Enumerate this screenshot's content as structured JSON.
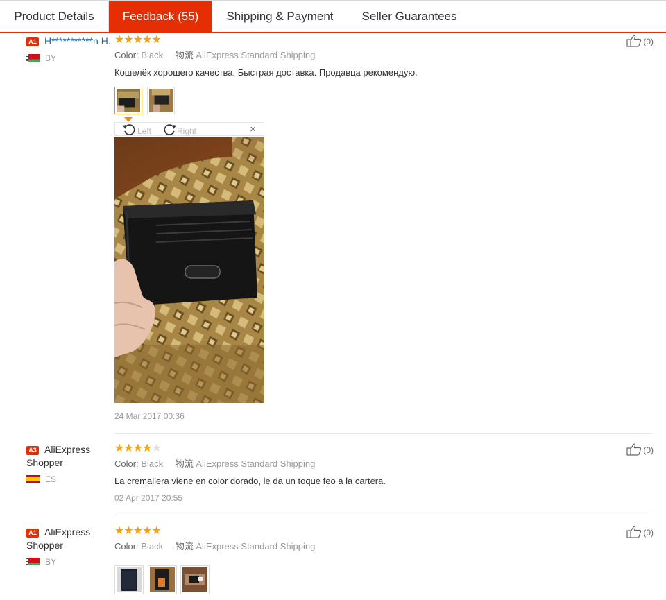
{
  "tabs": [
    {
      "label": "Product Details"
    },
    {
      "label": "Feedback (55)"
    },
    {
      "label": "Shipping & Payment"
    },
    {
      "label": "Seller Guarantees"
    }
  ],
  "reviews": [
    {
      "level": "A1",
      "name": "H***********n H.",
      "country": "BY",
      "rating": 5,
      "color_label": "Color:",
      "color_value": "Black",
      "shipping_label": "物流",
      "shipping_value": "AliExpress Standard Shipping",
      "text": "Кошелёк хорошего качества. Быстрая доставка. Продавца рекомендую.",
      "date": "24 Mar 2017 00:36",
      "helpful": "(0)",
      "viewer": {
        "rotate_left": "Left",
        "rotate_right": "Right",
        "close": "×"
      }
    },
    {
      "level": "A3",
      "name": "AliExpress Shopper",
      "country": "ES",
      "rating": 4,
      "color_label": "Color:",
      "color_value": "Black",
      "shipping_label": "物流",
      "shipping_value": "AliExpress Standard Shipping",
      "text": "La cremallera viene en color dorado, le da un toque feo a la cartera.",
      "date": "02 Apr 2017 20:55",
      "helpful": "(0)"
    },
    {
      "level": "A1",
      "name": "AliExpress Shopper",
      "country": "BY",
      "rating": 5,
      "color_label": "Color:",
      "color_value": "Black",
      "shipping_label": "物流",
      "shipping_value": "AliExpress Standard Shipping",
      "helpful": "(0)"
    }
  ],
  "colors": {
    "accent": "#e62e04",
    "star": "#f5a20a",
    "link": "#1c69b1"
  }
}
